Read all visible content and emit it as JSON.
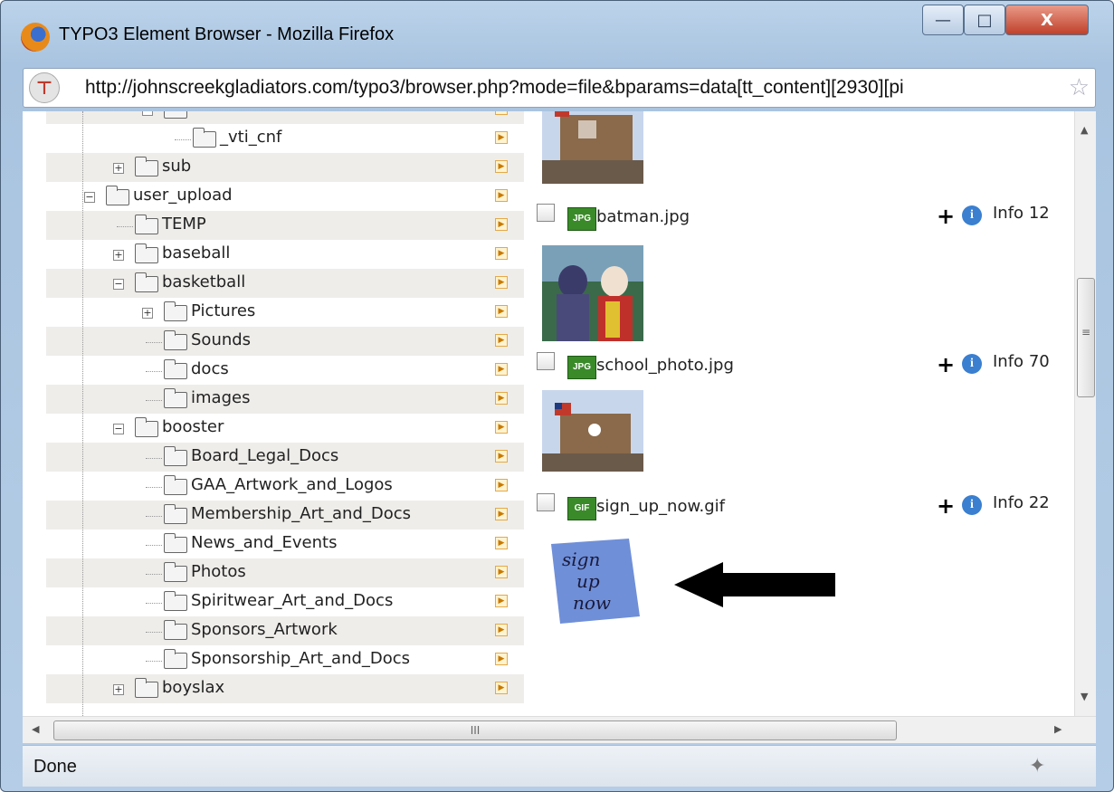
{
  "window": {
    "title": "TYPO3 Element Browser - Mozilla Firefox",
    "close_glyph": "X",
    "min_glyph": "—",
    "max_glyph": "□"
  },
  "address_bar": {
    "url": "http://johnscreekgladiators.com/typo3/browser.php?mode=file&bparams=data[tt_content][2930][pi"
  },
  "folder_tree": {
    "items": [
      {
        "label": "",
        "level": 2,
        "expander": "minus"
      },
      {
        "label": "_vti_cnf",
        "level": 3,
        "expander": ""
      },
      {
        "label": "sub",
        "level": 1,
        "expander": "plus"
      },
      {
        "label": "user_upload",
        "level": 0,
        "expander": "minus"
      },
      {
        "label": "TEMP",
        "level": 1,
        "expander": ""
      },
      {
        "label": "baseball",
        "level": 1,
        "expander": "plus"
      },
      {
        "label": "basketball",
        "level": 1,
        "expander": "minus"
      },
      {
        "label": "Pictures",
        "level": 2,
        "expander": "plus"
      },
      {
        "label": "Sounds",
        "level": 2,
        "expander": ""
      },
      {
        "label": "docs",
        "level": 2,
        "expander": ""
      },
      {
        "label": "images",
        "level": 2,
        "expander": ""
      },
      {
        "label": "booster",
        "level": 1,
        "expander": "minus"
      },
      {
        "label": "Board_Legal_Docs",
        "level": 2,
        "expander": ""
      },
      {
        "label": "GAA_Artwork_and_Logos",
        "level": 2,
        "expander": ""
      },
      {
        "label": "Membership_Art_and_Docs",
        "level": 2,
        "expander": ""
      },
      {
        "label": "News_and_Events",
        "level": 2,
        "expander": ""
      },
      {
        "label": "Photos",
        "level": 2,
        "expander": ""
      },
      {
        "label": "Spiritwear_Art_and_Docs",
        "level": 2,
        "expander": ""
      },
      {
        "label": "Sponsors_Artwork",
        "level": 2,
        "expander": ""
      },
      {
        "label": "Sponsorship_Art_and_Docs",
        "level": 2,
        "expander": ""
      },
      {
        "label": "boyslax",
        "level": 1,
        "expander": "plus"
      }
    ]
  },
  "file_list": {
    "files": [
      {
        "name": "batman.jpg",
        "type": "JPG",
        "info_label": "Info",
        "size_fragment": "12",
        "add_glyph": "+"
      },
      {
        "name": "school_photo.jpg",
        "type": "JPG",
        "info_label": "Info",
        "size_fragment": "70",
        "add_glyph": "+"
      },
      {
        "name": "sign_up_now.gif",
        "type": "GIF",
        "info_label": "Info",
        "size_fragment": "22",
        "add_glyph": "+"
      }
    ],
    "sign_up_thumb_text": [
      "sign",
      "up",
      "now"
    ]
  },
  "scrollbar": {
    "h_grip": "III",
    "v_grip": "≡"
  },
  "status_bar": {
    "text": "Done"
  },
  "colors": {
    "arrow_annotation": "#000000",
    "tree_shade": "#efedea"
  }
}
